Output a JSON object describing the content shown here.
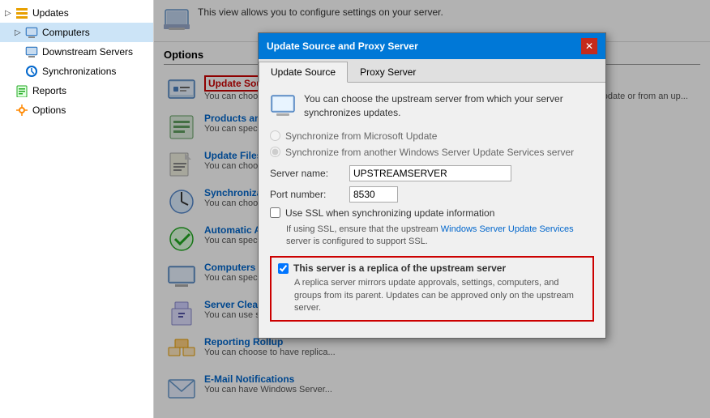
{
  "sidebar": {
    "items": [
      {
        "id": "updates",
        "label": "Updates",
        "arrow": "▷",
        "icon": "⬛",
        "indent": 0
      },
      {
        "id": "computers",
        "label": "Computers",
        "arrow": "▷",
        "icon": "🖥",
        "indent": 1
      },
      {
        "id": "downstream",
        "label": "Downstream Servers",
        "arrow": "",
        "icon": "🖥",
        "indent": 1
      },
      {
        "id": "synchronizations",
        "label": "Synchronizations",
        "arrow": "",
        "icon": "🔄",
        "indent": 1
      },
      {
        "id": "reports",
        "label": "Reports",
        "arrow": "",
        "icon": "📊",
        "indent": 0
      },
      {
        "id": "options",
        "label": "Options",
        "arrow": "",
        "icon": "⚙",
        "indent": 0
      }
    ]
  },
  "infobar": {
    "text": "This view allows you to configure settings on your server."
  },
  "options": {
    "header": "Options",
    "items": [
      {
        "id": "update-source",
        "title": "Update Source and Proxy Server",
        "desc": "You can choose whether this Windows Server Update Services server synchronizes from Microsoft Update or from an up...",
        "highlighted": true
      },
      {
        "id": "products",
        "title": "Products and Classifications",
        "desc": "You can specify the products fa..."
      },
      {
        "id": "update-files",
        "title": "Update Files and Languages",
        "desc": "You can choose whether to do..."
      },
      {
        "id": "sync-schedule",
        "title": "Synchronization Schedule",
        "desc": "You can choose to synchronize..."
      },
      {
        "id": "auto-approvals",
        "title": "Automatic Approvals",
        "desc": "You can specify how to automa..."
      },
      {
        "id": "computers",
        "title": "Computers",
        "desc": "You can specify how to assign..."
      },
      {
        "id": "cleanup",
        "title": "Server Cleanup Wizard",
        "desc": "You can use server cleanup to f..."
      },
      {
        "id": "reporting-rollup",
        "title": "Reporting Rollup",
        "desc": "You can choose to have replica..."
      },
      {
        "id": "email",
        "title": "E-Mail Notifications",
        "desc": "You can have Windows Server..."
      }
    ]
  },
  "dialog": {
    "title": "Update Source and Proxy Server",
    "close_label": "✕",
    "tabs": [
      "Update Source",
      "Proxy Server"
    ],
    "active_tab": "Update Source",
    "intro_text": "You can choose the upstream server from which your server synchronizes updates.",
    "radio1": "Synchronize from Microsoft Update",
    "radio2": "Synchronize from another Windows Server Update Services server",
    "server_label": "Server name:",
    "server_value": "UPSTREAMSERVER",
    "port_label": "Port number:",
    "port_value": "8530",
    "ssl_checkbox_label": "Use SSL when synchronizing update information",
    "ssl_note": "If using SSL, ensure that the upstream Windows Server Update Services server is configured to support SSL.",
    "ssl_note_link": "Windows Server Update Services",
    "replica_checkbox_label": "This server is a replica of the upstream server",
    "replica_checked": true,
    "replica_desc": "A replica server mirrors update approvals, settings, computers, and groups from its parent. Updates can be approved only on the upstream server."
  }
}
